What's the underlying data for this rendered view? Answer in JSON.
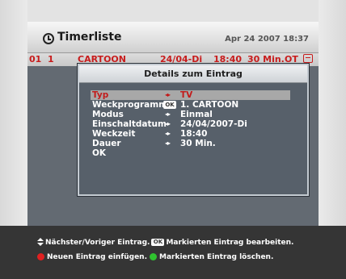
{
  "window": {
    "title": "Timerliste",
    "datetime": "Apr 24 2007 18:37",
    "clock_icon": "clock-icon"
  },
  "timer_row": {
    "index": "01",
    "channel_no": "1",
    "channel": "CARTOON",
    "date": "24/04-Di",
    "time": "18:40",
    "duration": "30 Min.",
    "mode": "OT",
    "icon": "record-icon"
  },
  "dialog": {
    "title": "Details zum Eintrag",
    "rows": [
      {
        "label": "Typ",
        "indicator": "◂▸",
        "value": "TV",
        "selected": true
      },
      {
        "label": "Weckprogramm",
        "indicator": "OK",
        "value": "1. CARTOON"
      },
      {
        "label": "Modus",
        "indicator": "◂▸",
        "value": "Einmal"
      },
      {
        "label": "Einschaltdatum",
        "indicator": "◂▸",
        "value": "24/04/2007-Di"
      },
      {
        "label": "Weckzeit",
        "indicator": "◂▸",
        "value": "18:40"
      },
      {
        "label": "Dauer",
        "indicator": "◂▸",
        "value": "30 Min."
      },
      {
        "label": "OK",
        "indicator": "",
        "value": ""
      }
    ]
  },
  "help": {
    "line1_nav": "Nächster/Voriger Eintrag.",
    "ok_key": "OK",
    "line1_edit": "Markierten Eintrag bearbeiten.",
    "line2_red": "Neuen Eintrag einfügen.",
    "line2_green": "Markierten Eintrag löschen.",
    "colors": {
      "red": "#e02020",
      "green": "#2fc22f",
      "selected_text": "#c21b1b"
    }
  }
}
